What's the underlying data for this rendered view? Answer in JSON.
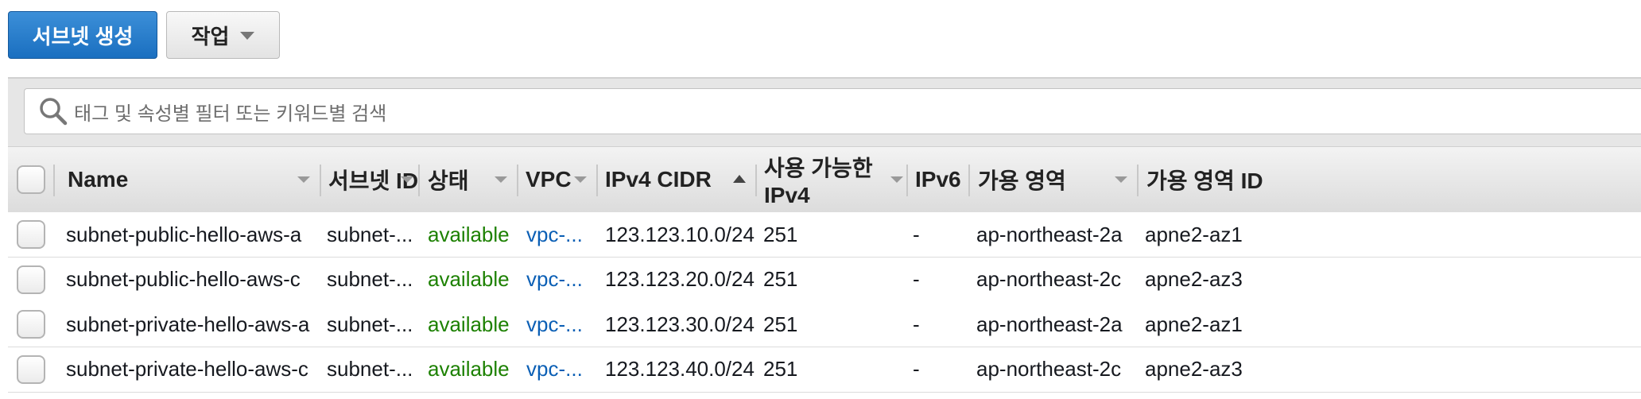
{
  "toolbar": {
    "create_label": "서브넷 생성",
    "actions_label": "작업"
  },
  "search": {
    "placeholder": "태그 및 속성별 필터 또는 키워드별 검색"
  },
  "columns": [
    {
      "label": "Name"
    },
    {
      "label": "서브넷 ID"
    },
    {
      "label": "상태"
    },
    {
      "label": "VPC"
    },
    {
      "label": "IPv4 CIDR"
    },
    {
      "label": "사용 가능한 IPv4"
    },
    {
      "label": "IPv6"
    },
    {
      "label": "가용 영역"
    },
    {
      "label": "가용 영역 ID"
    }
  ],
  "rows": [
    {
      "name": "subnet-public-hello-aws-a",
      "subnet_id": "subnet-...",
      "state": "available",
      "vpc": "vpc-...",
      "cidr": "123.123.10.0/24",
      "ipv4": "251",
      "ipv6": "-",
      "az": "ap-northeast-2a",
      "az_id": "apne2-az1"
    },
    {
      "name": "subnet-public-hello-aws-c",
      "subnet_id": "subnet-...",
      "state": "available",
      "vpc": "vpc-...",
      "cidr": "123.123.20.0/24",
      "ipv4": "251",
      "ipv6": "-",
      "az": "ap-northeast-2c",
      "az_id": "apne2-az3"
    },
    {
      "name": "subnet-private-hello-aws-a",
      "subnet_id": "subnet-...",
      "state": "available",
      "vpc": "vpc-...",
      "cidr": "123.123.30.0/24",
      "ipv4": "251",
      "ipv6": "-",
      "az": "ap-northeast-2a",
      "az_id": "apne2-az1"
    },
    {
      "name": "subnet-private-hello-aws-c",
      "subnet_id": "subnet-...",
      "state": "available",
      "vpc": "vpc-...",
      "cidr": "123.123.40.0/24",
      "ipv4": "251",
      "ipv6": "-",
      "az": "ap-northeast-2c",
      "az_id": "apne2-az3"
    }
  ],
  "colors": {
    "primary": "#1a6fc0",
    "available": "#1d8102",
    "link": "#0b5fb5"
  }
}
